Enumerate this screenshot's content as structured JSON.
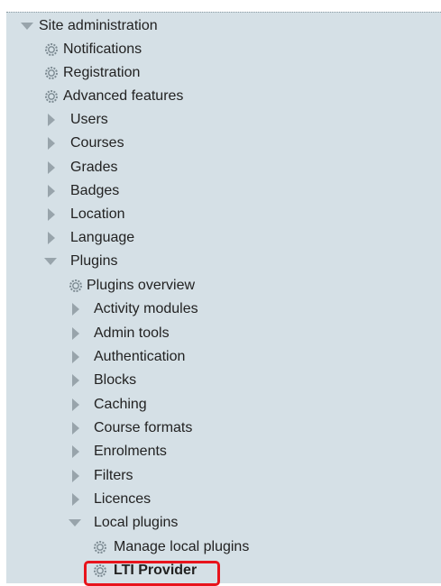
{
  "tree": {
    "root": {
      "label": "Site administration",
      "icon": "triangle-down-icon"
    },
    "items": [
      {
        "label": "Notifications",
        "icon": "gear-icon"
      },
      {
        "label": "Registration",
        "icon": "gear-icon"
      },
      {
        "label": "Advanced features",
        "icon": "gear-icon"
      },
      {
        "label": "Users",
        "icon": "triangle-right-icon"
      },
      {
        "label": "Courses",
        "icon": "triangle-right-icon"
      },
      {
        "label": "Grades",
        "icon": "triangle-right-icon"
      },
      {
        "label": "Badges",
        "icon": "triangle-right-icon"
      },
      {
        "label": "Location",
        "icon": "triangle-right-icon"
      },
      {
        "label": "Language",
        "icon": "triangle-right-icon"
      },
      {
        "label": "Plugins",
        "icon": "triangle-down-icon"
      }
    ],
    "plugins": [
      {
        "label": "Plugins overview",
        "icon": "gear-icon"
      },
      {
        "label": "Activity modules",
        "icon": "triangle-right-icon"
      },
      {
        "label": "Admin tools",
        "icon": "triangle-right-icon"
      },
      {
        "label": "Authentication",
        "icon": "triangle-right-icon"
      },
      {
        "label": "Blocks",
        "icon": "triangle-right-icon"
      },
      {
        "label": "Caching",
        "icon": "triangle-right-icon"
      },
      {
        "label": "Course formats",
        "icon": "triangle-right-icon"
      },
      {
        "label": "Enrolments",
        "icon": "triangle-right-icon"
      },
      {
        "label": "Filters",
        "icon": "triangle-right-icon"
      },
      {
        "label": "Licences",
        "icon": "triangle-right-icon"
      },
      {
        "label": "Local plugins",
        "icon": "triangle-down-icon"
      }
    ],
    "local_plugins": [
      {
        "label": "Manage local plugins",
        "icon": "gear-icon"
      },
      {
        "label": "LTI Provider",
        "icon": "gear-icon",
        "highlighted": true
      }
    ]
  },
  "colors": {
    "panel_bg": "#d5e0e6",
    "highlight_border": "#e8141c",
    "arrow": "#98a4ab"
  }
}
